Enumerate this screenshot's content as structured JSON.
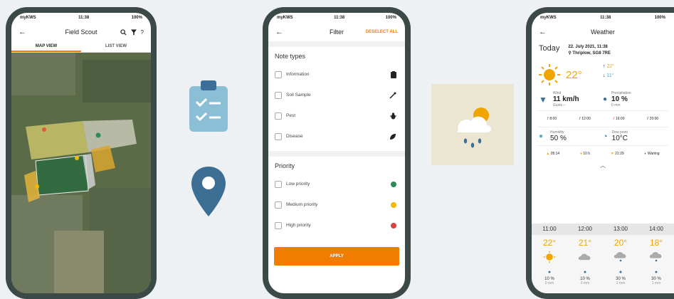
{
  "status": {
    "carrier": "myKWS",
    "time": "11:38",
    "battery": "100%"
  },
  "field_scout": {
    "title": "Field Scout",
    "tabs": [
      "MAP VIEW",
      "LIST VIEW"
    ],
    "active_tab": "MAP VIEW",
    "icons": [
      "back-arrow-icon",
      "search-icon",
      "filter-icon",
      "help-icon"
    ]
  },
  "filter": {
    "title": "Filter",
    "deselect_label": "DESELECT ALL",
    "note_types_title": "Note types",
    "note_types": [
      {
        "label": "Information",
        "icon": "clipboard-icon"
      },
      {
        "label": "Soil Sample",
        "icon": "soil-sample-icon"
      },
      {
        "label": "Pest",
        "icon": "bug-icon"
      },
      {
        "label": "Disease",
        "icon": "leaf-icon"
      }
    ],
    "priority_title": "Priority",
    "priorities": [
      {
        "label": "Low priority",
        "color": "#2e8b57"
      },
      {
        "label": "Medium priority",
        "color": "#f5b800"
      },
      {
        "label": "High priority",
        "color": "#d94040"
      }
    ],
    "apply_label": "APPLY"
  },
  "weather": {
    "title": "Weather",
    "today_label": "Today",
    "date": "22. July 2021, 11:38",
    "location": "Thriplow, SG8 7RE",
    "temp": "22°",
    "high": "22°",
    "low": "11°",
    "wind_label": "Wind",
    "wind_value": "11 km/h",
    "wind_gusts": "Gusts –",
    "precip_label": "Precipitation",
    "precip_value": "10 %",
    "precip_amount": "0 mm",
    "times": [
      "8:00",
      "12:00",
      "16:00",
      "20:00"
    ],
    "humidity_label": "Humidity",
    "humidity_value": "50 %",
    "dewpoint_label": "Dew point",
    "dewpoint_value": "10°C",
    "sunrise": "05:14",
    "daylight": "10 h",
    "sunset": "21:29",
    "moon": "Waning",
    "hourly": [
      {
        "time": "11:00",
        "temp": "22°",
        "icon": "sun-icon",
        "pct": "10 %",
        "mm": "0 mm"
      },
      {
        "time": "12:00",
        "temp": "21°",
        "icon": "cloud-icon",
        "pct": "10 %",
        "mm": "0 mm"
      },
      {
        "time": "13:00",
        "temp": "20°",
        "icon": "rain-cloud-icon",
        "pct": "30 %",
        "mm": "1 mm"
      },
      {
        "time": "14:00",
        "temp": "18°",
        "icon": "rain-cloud-icon",
        "pct": "30 %",
        "mm": "1 mm"
      }
    ]
  },
  "center_icons": [
    "clipboard-checklist-icon",
    "location-pin-icon",
    "weather-sun-rain-icon"
  ]
}
